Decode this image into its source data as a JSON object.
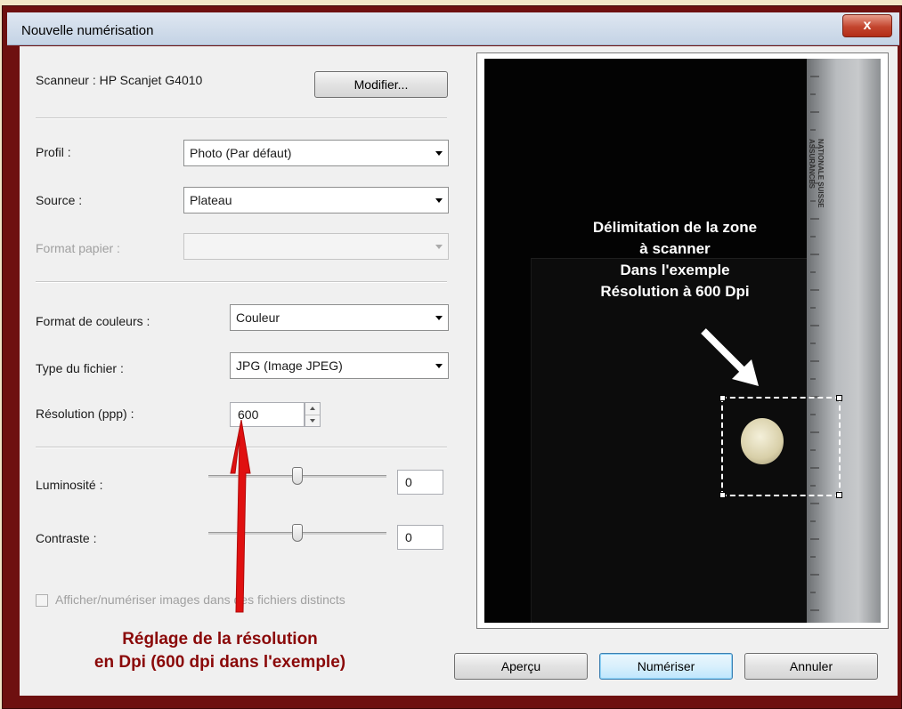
{
  "window": {
    "title": "Nouvelle numérisation",
    "close_glyph": "x"
  },
  "scanner": {
    "label": "Scanneur : HP Scanjet G4010",
    "modify_button": "Modifier..."
  },
  "profile": {
    "label": "Profil :",
    "value": "Photo (Par défaut)"
  },
  "source": {
    "label": "Source :",
    "value": "Plateau"
  },
  "paper_format": {
    "label": "Format papier :",
    "value": ""
  },
  "color_format": {
    "label": "Format de couleurs :",
    "value": "Couleur"
  },
  "file_type": {
    "label": "Type du fichier :",
    "value": "JPG (Image JPEG)"
  },
  "resolution": {
    "label": "Résolution (ppp) :",
    "value": "600"
  },
  "brightness": {
    "label": "Luminosité :",
    "value": "0",
    "level": 0.5
  },
  "contrast": {
    "label": "Contraste :",
    "value": "0",
    "level": 0.5
  },
  "separate_files": {
    "label": "Afficher/numériser images dans des fichiers distincts",
    "checked": false
  },
  "buttons": {
    "preview": "Aperçu",
    "scan": "Numériser",
    "cancel": "Annuler"
  },
  "preview_annotation": [
    "Délimitation de la zone",
    "à scanner",
    "Dans l'exemple",
    "Résolution à 600 Dpi"
  ],
  "ruler_brand": [
    "NATIONALE SUISSE",
    "ASSURANCES"
  ],
  "red_annotation": [
    "Réglage de la résolution",
    "en Dpi (600 dpi dans l'exemple)"
  ],
  "colors": {
    "annotation_red": "#e01010",
    "annotation_text_red": "#8a0808",
    "frame": "#6e1010",
    "background": "#f1e6c8"
  },
  "icons": {
    "close": "close-icon",
    "dropdown": "chevron-down-icon",
    "spin_up": "spin-up-icon",
    "spin_down": "spin-down-icon",
    "arrow_white": "arrow-icon",
    "arrow_red": "arrow-icon"
  }
}
